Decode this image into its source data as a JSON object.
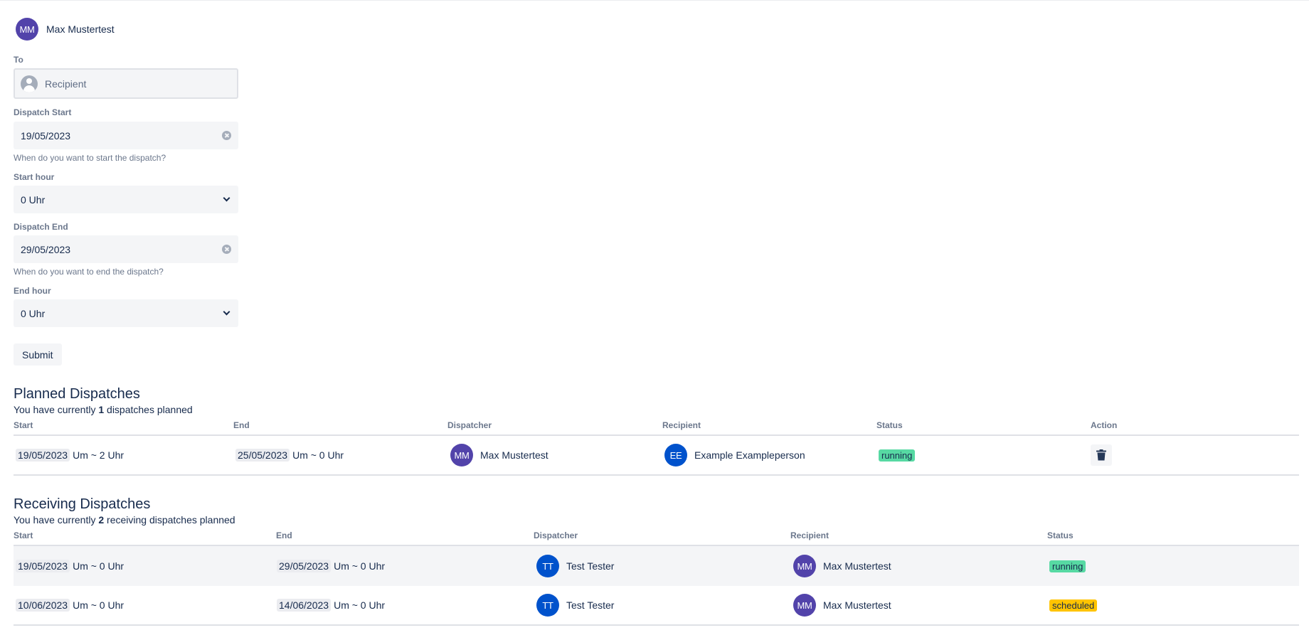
{
  "user": {
    "name": "Max Mustertest",
    "initials": "MM"
  },
  "form": {
    "to_label": "To",
    "recipient_placeholder": "Recipient",
    "dispatch_start_label": "Dispatch Start",
    "dispatch_start_value": "19/05/2023",
    "dispatch_start_help": "When do you want to start the dispatch?",
    "start_hour_label": "Start hour",
    "start_hour_value": "0 Uhr",
    "dispatch_end_label": "Dispatch End",
    "dispatch_end_value": "29/05/2023",
    "dispatch_end_help": "When do you want to end the dispatch?",
    "end_hour_label": "End hour",
    "end_hour_value": "0 Uhr",
    "submit_label": "Submit"
  },
  "planned": {
    "title": "Planned Dispatches",
    "summary_prefix": "You have currently ",
    "count": "1",
    "summary_suffix": " dispatches planned",
    "columns": {
      "start": "Start",
      "end": "End",
      "dispatcher": "Dispatcher",
      "recipient": "Recipient",
      "status": "Status",
      "action": "Action"
    },
    "rows": [
      {
        "start_date": "19/05/2023",
        "start_time": "Um ~ 2 Uhr",
        "end_date": "25/05/2023",
        "end_time": "Um ~ 0 Uhr",
        "dispatcher_initials": "MM",
        "dispatcher": "Max Mustertest",
        "recipient_initials": "EE",
        "recipient": "Example Exampleperson",
        "status": "running"
      }
    ]
  },
  "receiving": {
    "title": "Receiving Dispatches",
    "summary_prefix": "You have currently ",
    "count": "2",
    "summary_suffix": " receiving dispatches planned",
    "columns": {
      "start": "Start",
      "end": "End",
      "dispatcher": "Dispatcher",
      "recipient": "Recipient",
      "status": "Status"
    },
    "rows": [
      {
        "start_date": "19/05/2023",
        "start_time": "Um ~ 0 Uhr",
        "end_date": "29/05/2023",
        "end_time": "Um ~ 0 Uhr",
        "dispatcher_initials": "TT",
        "dispatcher": "Test Tester",
        "recipient_initials": "MM",
        "recipient": "Max Mustertest",
        "status": "running"
      },
      {
        "start_date": "10/06/2023",
        "start_time": "Um ~ 0 Uhr",
        "end_date": "14/06/2023",
        "end_time": "Um ~ 0 Uhr",
        "dispatcher_initials": "TT",
        "dispatcher": "Test Tester",
        "recipient_initials": "MM",
        "recipient": "Max Mustertest",
        "status": "scheduled"
      }
    ]
  },
  "colors": {
    "avatar_mm": "#5243aa",
    "avatar_blue": "#0052cc",
    "running": "#57d9a3",
    "scheduled": "#ffc400"
  },
  "icons": [
    "person-icon",
    "clear-icon",
    "chevron-down-icon",
    "trash-icon"
  ]
}
